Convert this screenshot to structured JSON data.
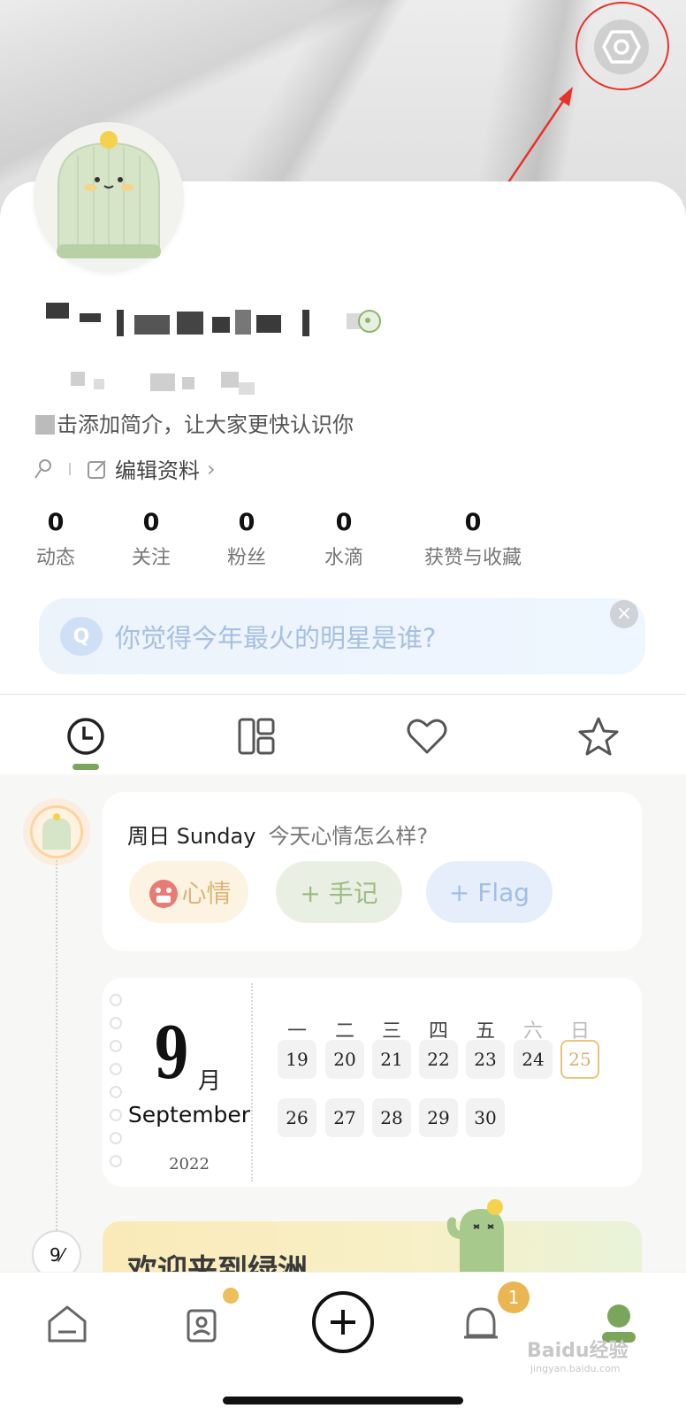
{
  "profile": {
    "bio_placeholder": "击添加简介，让大家更快认识你",
    "edit_label": "编辑资料",
    "edit_chevron": "›"
  },
  "stats": [
    {
      "value": "0",
      "label": "动态"
    },
    {
      "value": "0",
      "label": "关注"
    },
    {
      "value": "0",
      "label": "粉丝"
    },
    {
      "value": "0",
      "label": "水滴"
    },
    {
      "value": "0",
      "label": "获赞与收藏"
    }
  ],
  "question": {
    "badge": "Q",
    "text": "你觉得今年最火的明星是谁?",
    "close_symbol": "×"
  },
  "tabs": [
    {
      "icon": "clock-icon",
      "active": true
    },
    {
      "icon": "grid-icon"
    },
    {
      "icon": "heart-icon"
    },
    {
      "icon": "star-icon"
    }
  ],
  "mood_card": {
    "day_label": "周日 Sunday",
    "prompt": "今天心情怎么样?",
    "mood_button": "心情",
    "note_button": "+ 手记",
    "flag_button": "+ Flag"
  },
  "calendar": {
    "day": "9",
    "month_cn": "月",
    "month_en": "September",
    "year": "2022",
    "weekdays": [
      "一",
      "二",
      "三",
      "四",
      "五",
      "六",
      "日"
    ],
    "week1": [
      "19",
      "20",
      "21",
      "22",
      "23",
      "24",
      "25"
    ],
    "week2": [
      "26",
      "27",
      "28",
      "29",
      "30"
    ],
    "today": "25"
  },
  "banner": {
    "text": "欢迎来到绿洲"
  },
  "timeline_badge": "9⁄",
  "bottom_nav": {
    "items": [
      "home-icon",
      "contacts-icon",
      "add-icon",
      "bell-icon",
      "profile-icon"
    ],
    "notification_count": "1"
  },
  "watermark": {
    "text": "Baidu经验",
    "sub": "jingyan.baidu.com"
  },
  "colors": {
    "accent_green": "#7ba55a",
    "highlight_red": "#e8322b",
    "badge_gold": "#eab652"
  }
}
